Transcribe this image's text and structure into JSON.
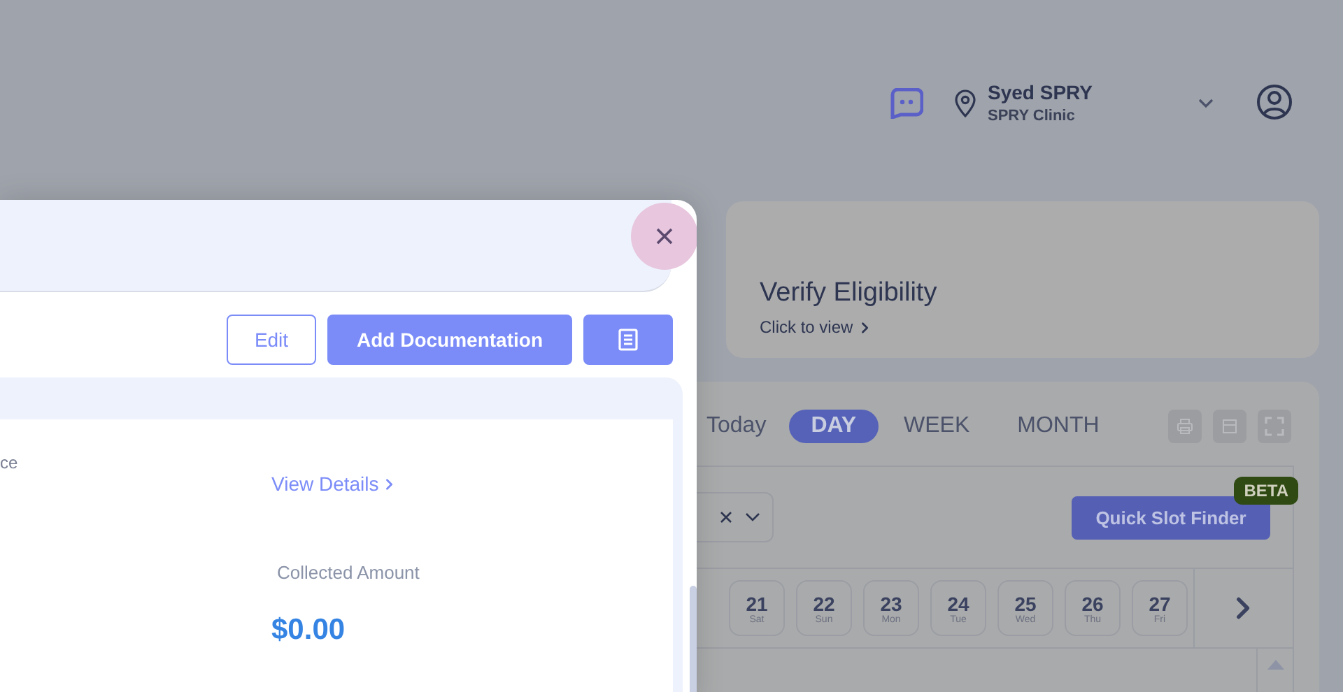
{
  "header": {
    "user_name": "Syed SPRY",
    "clinic": "SPRY Clinic"
  },
  "eligibility_card": {
    "title": "Verify Eligibility",
    "link": "Click to view"
  },
  "calendar": {
    "today_label": "Today",
    "views": [
      {
        "label": "DAY",
        "selected": true
      },
      {
        "label": "WEEK",
        "selected": false
      },
      {
        "label": "MONTH",
        "selected": false
      }
    ],
    "quick_slot_button": "Quick Slot Finder",
    "beta_badge": "BETA",
    "dates": [
      {
        "day": "21",
        "weekday": "Sat",
        "selected": false
      },
      {
        "day": "22",
        "weekday": "Sun",
        "selected": false
      },
      {
        "day": "23",
        "weekday": "Mon",
        "selected": false
      },
      {
        "day": "24",
        "weekday": "Tue",
        "selected": false
      },
      {
        "day": "25",
        "weekday": "Wed",
        "selected": false
      },
      {
        "day": "26",
        "weekday": "Thu",
        "selected": false
      },
      {
        "day": "27",
        "weekday": "Fri",
        "selected": false
      }
    ]
  },
  "modal": {
    "edit_button": "Edit",
    "add_documentation_button": "Add Documentation",
    "field_label": "ce",
    "view_details_link": "View Details",
    "collected_label": "Collected Amount",
    "collected_amount": "$0.00"
  }
}
